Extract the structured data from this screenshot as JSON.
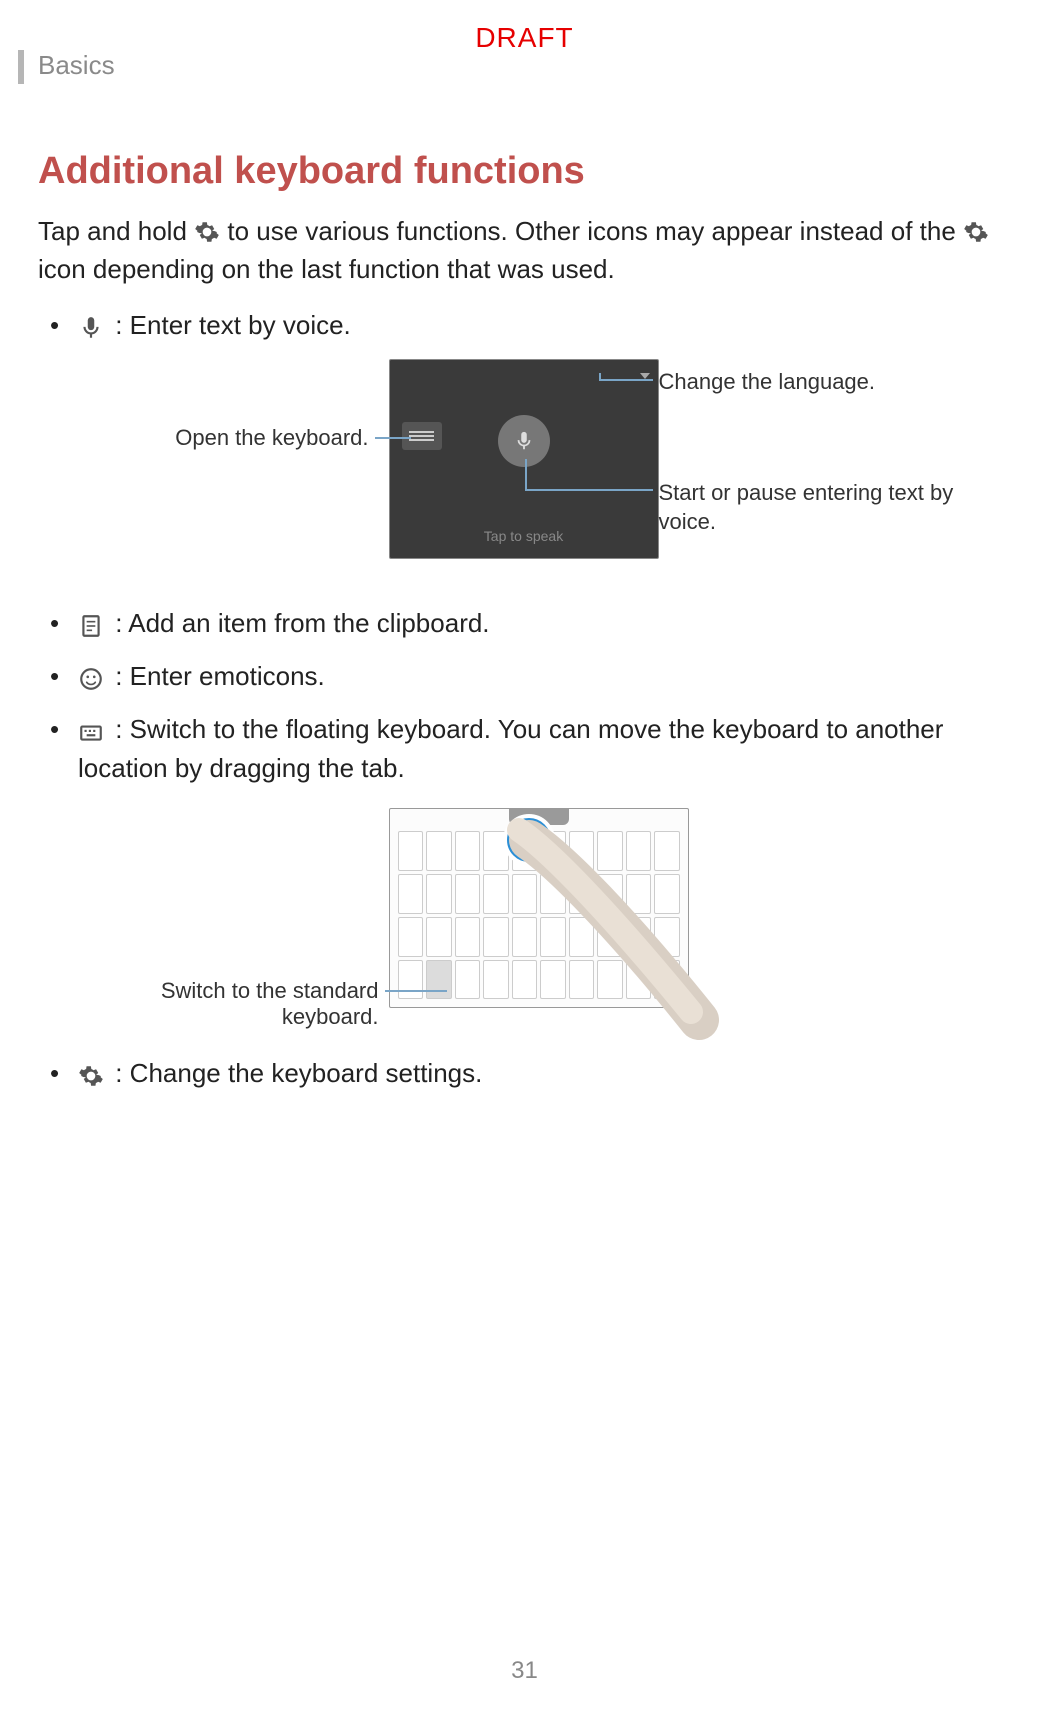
{
  "header": {
    "section": "Basics",
    "watermark": "DRAFT"
  },
  "title": "Additional keyboard functions",
  "intro_part1": "Tap and hold ",
  "intro_part2": " to use various functions. Other icons may appear instead of the ",
  "intro_part3": " icon depending on the last function that was used.",
  "bullets": {
    "voice": " : Enter text by voice.",
    "clipboard": " : Add an item from the clipboard.",
    "emoticons": " : Enter emoticons.",
    "floating": " : Switch to the floating keyboard. You can move the keyboard to another location by dragging the tab.",
    "settings": " : Change the keyboard settings."
  },
  "fig1": {
    "open_keyboard": "Open the keyboard.",
    "change_language": "Change the language.",
    "start_pause": "Start or pause entering text by voice.",
    "tap_to_speak": "Tap to speak"
  },
  "fig2": {
    "switch_standard": "Switch to the standard keyboard."
  },
  "page_number": "31"
}
